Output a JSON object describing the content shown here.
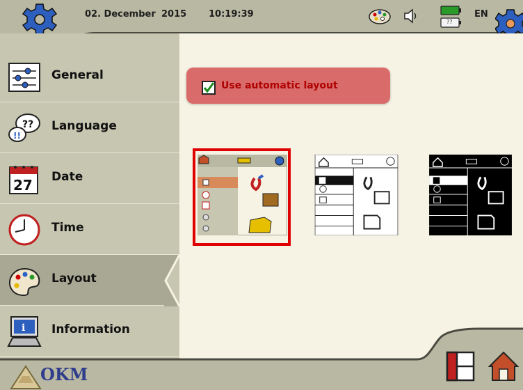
{
  "topbar": {
    "date": "02. December",
    "year": "2015",
    "time": "10:19:39",
    "language": "EN",
    "battery_text": "??"
  },
  "sidebar": {
    "items": [
      {
        "label": "General",
        "icon": "sliders-icon"
      },
      {
        "label": "Language",
        "icon": "speech-bubbles-icon"
      },
      {
        "label": "Date",
        "icon": "calendar-icon"
      },
      {
        "label": "Time",
        "icon": "clock-icon"
      },
      {
        "label": "Layout",
        "icon": "palette-icon",
        "active": true
      },
      {
        "label": "Information",
        "icon": "info-computer-icon"
      }
    ],
    "date_icon_day": "27"
  },
  "main": {
    "auto_layout_label": "Use automatic layout",
    "auto_layout_checked": true,
    "layouts": [
      {
        "name": "color",
        "selected": true
      },
      {
        "name": "white",
        "selected": false
      },
      {
        "name": "black",
        "selected": false
      }
    ]
  },
  "footer": {
    "logo_text": "OKM"
  },
  "colors": {
    "topbar": "#b9b9a3",
    "sidebar": "#c6c6b1",
    "active_item": "#a8a894",
    "background": "#f6f3e4",
    "auto_button": "#d96b6b",
    "selection": "#e00000"
  }
}
